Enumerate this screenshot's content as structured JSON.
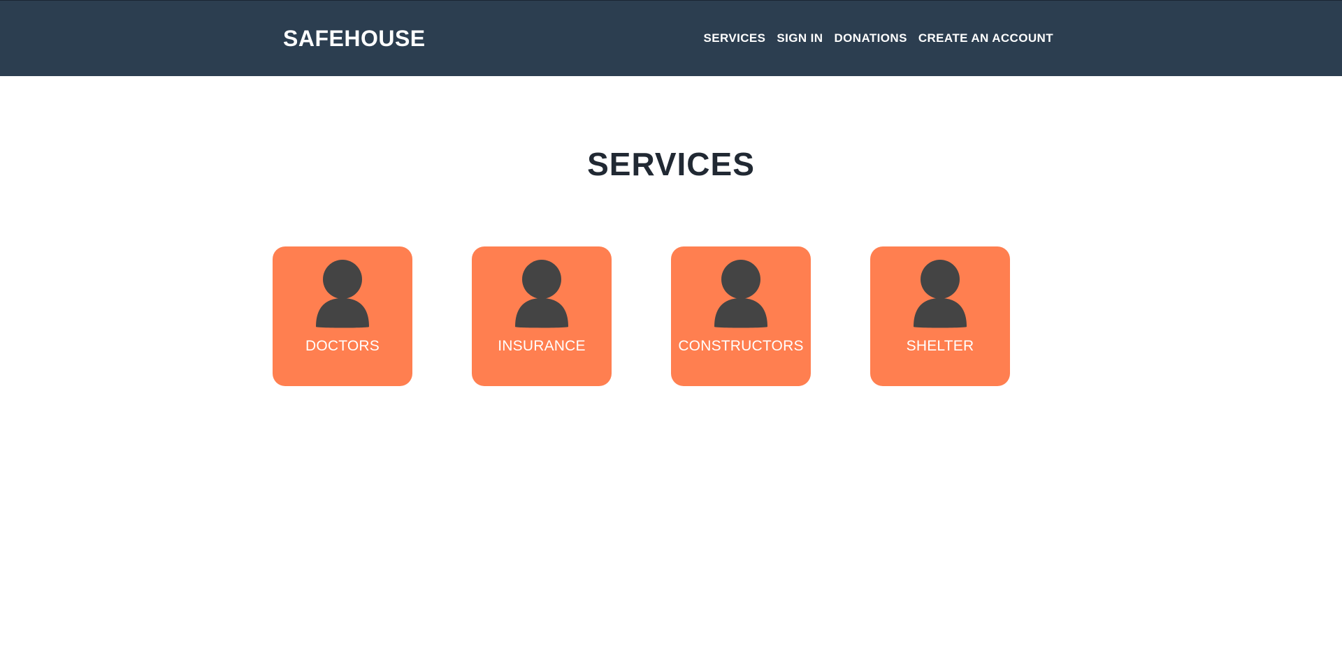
{
  "header": {
    "brand": "SAFEHOUSE",
    "nav": [
      {
        "label": "SERVICES"
      },
      {
        "label": "SIGN IN"
      },
      {
        "label": "DONATIONS"
      },
      {
        "label": "CREATE AN ACCOUNT"
      }
    ]
  },
  "main": {
    "title": "SERVICES",
    "services": [
      {
        "label": "DOCTORS",
        "icon": "user-icon"
      },
      {
        "label": "INSURANCE",
        "icon": "user-icon"
      },
      {
        "label": "CONSTRUCTORS",
        "icon": "user-icon"
      },
      {
        "label": "SHELTER",
        "icon": "user-icon"
      }
    ]
  },
  "colors": {
    "navbar": "#2c3e50",
    "card": "#ff7f50",
    "icon": "#444444",
    "title": "#212933"
  }
}
